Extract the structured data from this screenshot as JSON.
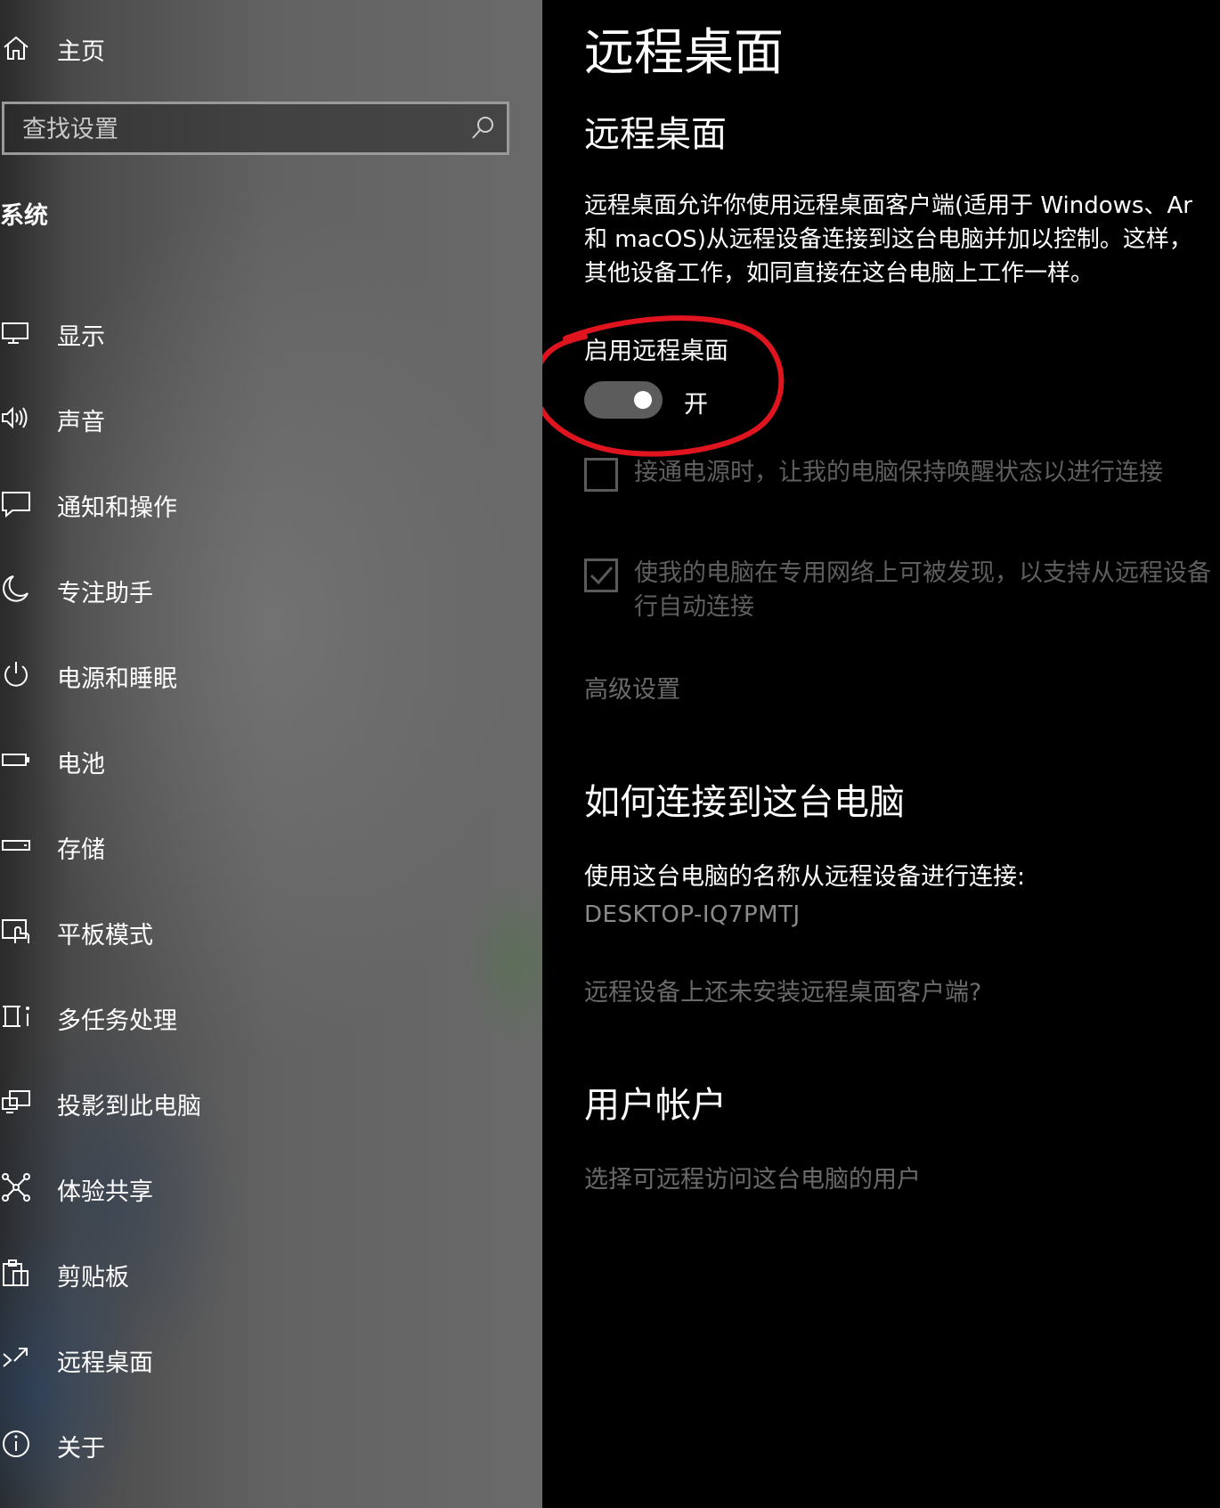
{
  "sidebar": {
    "home_label": "主页",
    "search_placeholder": "查找设置",
    "section_label": "系统",
    "items": [
      {
        "label": "显示",
        "icon": "monitor-icon"
      },
      {
        "label": "声音",
        "icon": "speaker-icon"
      },
      {
        "label": "通知和操作",
        "icon": "notification-icon"
      },
      {
        "label": "专注助手",
        "icon": "moon-icon"
      },
      {
        "label": "电源和睡眠",
        "icon": "power-icon"
      },
      {
        "label": "电池",
        "icon": "battery-icon"
      },
      {
        "label": "存储",
        "icon": "storage-icon"
      },
      {
        "label": "平板模式",
        "icon": "tablet-mode-icon"
      },
      {
        "label": "多任务处理",
        "icon": "multitasking-icon"
      },
      {
        "label": "投影到此电脑",
        "icon": "project-icon"
      },
      {
        "label": "体验共享",
        "icon": "shared-experiences-icon"
      },
      {
        "label": "剪贴板",
        "icon": "clipboard-icon"
      },
      {
        "label": "远程桌面",
        "icon": "remote-desktop-icon"
      },
      {
        "label": "关于",
        "icon": "info-icon"
      }
    ]
  },
  "main": {
    "page_title": "远程桌面",
    "section_title": "远程桌面",
    "description_lines": [
      "远程桌面允许你使用远程桌面客户端(适用于 Windows、Ar",
      "和 macOS)从远程设备连接到这台电脑并加以控制。这样，",
      "其他设备工作，如同直接在这台电脑上工作一样。"
    ],
    "toggle_label": "启用远程桌面",
    "toggle_state": "开",
    "toggle_on": true,
    "checkbox1_label": "接通电源时，让我的电脑保持唤醒状态以进行连接",
    "checkbox1_checked": false,
    "checkbox2_line1": "使我的电脑在专用网络上可被发现，以支持从远程设备",
    "checkbox2_line2": "行自动连接",
    "checkbox2_checked": true,
    "advanced_link": "高级设置",
    "how_to_title": "如何连接到这台电脑",
    "how_to_text": "使用这台电脑的名称从远程设备进行连接:",
    "pc_name": "DESKTOP-IQ7PMTJ",
    "no_client_link": "远程设备上还未安装远程桌面客户端?",
    "user_accounts_title": "用户帐户",
    "select_users_link": "选择可远程访问这台电脑的用户"
  },
  "colors": {
    "annotation_circle": "#e0141e",
    "toggle_track": "#5c5c5c",
    "dim_text": "#6a6a6a"
  }
}
